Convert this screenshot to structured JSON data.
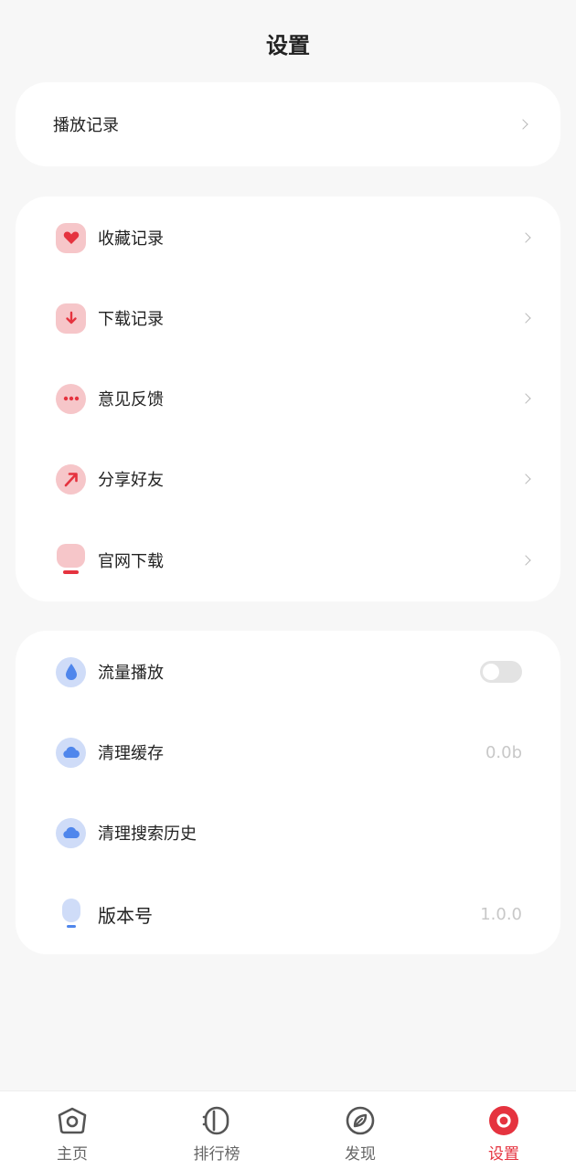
{
  "header": {
    "title": "设置"
  },
  "card1": {
    "items": [
      {
        "label": "播放记录"
      }
    ]
  },
  "card2": {
    "items": [
      {
        "label": "收藏记录",
        "icon": "heart-icon"
      },
      {
        "label": "下载记录",
        "icon": "download-icon"
      },
      {
        "label": "意见反馈",
        "icon": "feedback-icon"
      },
      {
        "label": "分享好友",
        "icon": "share-icon"
      },
      {
        "label": "官网下载",
        "icon": "website-icon"
      }
    ]
  },
  "card3": {
    "items": [
      {
        "label": "流量播放",
        "icon": "water-drop-icon",
        "toggle_on": false
      },
      {
        "label": "清理缓存",
        "icon": "cloud-icon",
        "value": "0.0b"
      },
      {
        "label": "清理搜索历史",
        "icon": "cloud-icon"
      },
      {
        "label": "版本号",
        "icon": "version-icon",
        "value": "1.0.0"
      }
    ]
  },
  "tabbar": {
    "tabs": [
      {
        "label": "主页",
        "icon": "home-icon"
      },
      {
        "label": "排行榜",
        "icon": "ranking-icon"
      },
      {
        "label": "发现",
        "icon": "discover-icon"
      },
      {
        "label": "设置",
        "icon": "settings-icon",
        "active": true
      }
    ]
  },
  "colors": {
    "accent": "#e5333f",
    "icon_red_bg": "#f6c6c9",
    "icon_blue_bg": "#cfdcf8",
    "background": "#f7f7f7"
  }
}
